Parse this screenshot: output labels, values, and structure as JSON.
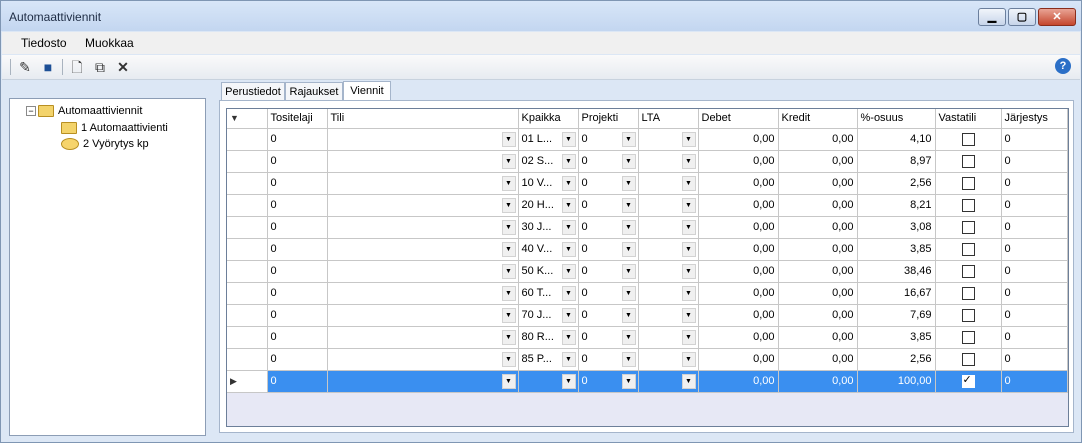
{
  "window": {
    "title": "Automaattiviennit",
    "min_label": "▁",
    "max_label": "▢",
    "close_label": "✕"
  },
  "menu": [
    "Tiedosto",
    "Muokkaa"
  ],
  "toolbar": {
    "icons": [
      "edit-icon",
      "save-icon",
      "new-document-icon",
      "copy-document-icon",
      "delete-icon"
    ],
    "help_icon": "help-icon",
    "help_label": "?"
  },
  "tree": {
    "root": "Automaattiviennit",
    "children": [
      "1 Automaattivienti",
      "2 Vyörytys kp"
    ]
  },
  "tabs": [
    {
      "label": "Perustiedot",
      "active": false
    },
    {
      "label": "Rajaukset",
      "active": false
    },
    {
      "label": "Viennit",
      "active": true
    }
  ],
  "grid": {
    "header_icon": "sort-icon",
    "columns": [
      "Tositelaji",
      "Tili",
      "Kpaikka",
      "Projekti",
      "LTA",
      "Debet",
      "Kredit",
      "%-osuus",
      "Vastatili",
      "Järjestys"
    ],
    "rows": [
      {
        "tositelaji": "0",
        "tili": "",
        "kpaikka": "01 L...",
        "projekti": "0",
        "lta": "",
        "debet": "0,00",
        "kredit": "0,00",
        "osuus": "4,10",
        "vastatili": false,
        "jarjestys": "0"
      },
      {
        "tositelaji": "0",
        "tili": "",
        "kpaikka": "02 S...",
        "projekti": "0",
        "lta": "",
        "debet": "0,00",
        "kredit": "0,00",
        "osuus": "8,97",
        "vastatili": false,
        "jarjestys": "0"
      },
      {
        "tositelaji": "0",
        "tili": "",
        "kpaikka": "10 V...",
        "projekti": "0",
        "lta": "",
        "debet": "0,00",
        "kredit": "0,00",
        "osuus": "2,56",
        "vastatili": false,
        "jarjestys": "0"
      },
      {
        "tositelaji": "0",
        "tili": "",
        "kpaikka": "20 H...",
        "projekti": "0",
        "lta": "",
        "debet": "0,00",
        "kredit": "0,00",
        "osuus": "8,21",
        "vastatili": false,
        "jarjestys": "0"
      },
      {
        "tositelaji": "0",
        "tili": "",
        "kpaikka": "30 J...",
        "projekti": "0",
        "lta": "",
        "debet": "0,00",
        "kredit": "0,00",
        "osuus": "3,08",
        "vastatili": false,
        "jarjestys": "0"
      },
      {
        "tositelaji": "0",
        "tili": "",
        "kpaikka": "40 V...",
        "projekti": "0",
        "lta": "",
        "debet": "0,00",
        "kredit": "0,00",
        "osuus": "3,85",
        "vastatili": false,
        "jarjestys": "0"
      },
      {
        "tositelaji": "0",
        "tili": "",
        "kpaikka": "50 K...",
        "projekti": "0",
        "lta": "",
        "debet": "0,00",
        "kredit": "0,00",
        "osuus": "38,46",
        "vastatili": false,
        "jarjestys": "0"
      },
      {
        "tositelaji": "0",
        "tili": "",
        "kpaikka": "60 T...",
        "projekti": "0",
        "lta": "",
        "debet": "0,00",
        "kredit": "0,00",
        "osuus": "16,67",
        "vastatili": false,
        "jarjestys": "0"
      },
      {
        "tositelaji": "0",
        "tili": "",
        "kpaikka": "70 J...",
        "projekti": "0",
        "lta": "",
        "debet": "0,00",
        "kredit": "0,00",
        "osuus": "7,69",
        "vastatili": false,
        "jarjestys": "0"
      },
      {
        "tositelaji": "0",
        "tili": "",
        "kpaikka": "80 R...",
        "projekti": "0",
        "lta": "",
        "debet": "0,00",
        "kredit": "0,00",
        "osuus": "3,85",
        "vastatili": false,
        "jarjestys": "0"
      },
      {
        "tositelaji": "0",
        "tili": "",
        "kpaikka": "85 P...",
        "projekti": "0",
        "lta": "",
        "debet": "0,00",
        "kredit": "0,00",
        "osuus": "2,56",
        "vastatili": false,
        "jarjestys": "0"
      },
      {
        "tositelaji": "0",
        "tili": "",
        "kpaikka": "",
        "projekti": "0",
        "lta": "",
        "debet": "0,00",
        "kredit": "0,00",
        "osuus": "100,00",
        "vastatili": true,
        "jarjestys": "0",
        "selected": true
      }
    ]
  }
}
